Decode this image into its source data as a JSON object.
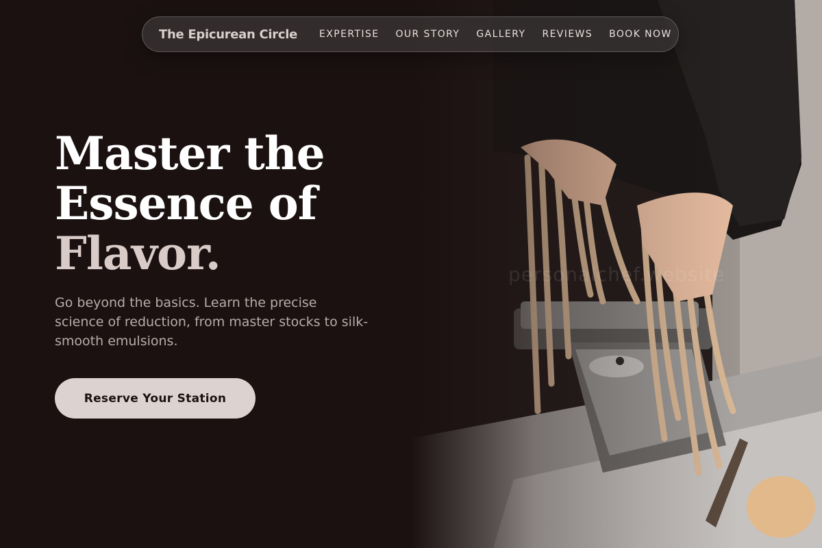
{
  "nav": {
    "brand": "The Epicurean Circle",
    "links": [
      "EXPERTISE",
      "OUR STORY",
      "GALLERY",
      "REVIEWS",
      "BOOK NOW"
    ]
  },
  "hero": {
    "headline_line1": "Master the",
    "headline_line2": "Essence of",
    "headline_line3": "Flavor.",
    "subtitle": "Go beyond the basics. Learn the precise science of reduction, from master stocks to silk-smooth emulsions.",
    "cta_label": "Reserve Your Station",
    "watermark": "personalchef.website"
  },
  "colors": {
    "background": "#1b1111",
    "accent": "#dcd2cf",
    "headline": "#ffffff",
    "subtitle": "#b8adaa"
  },
  "icons": [
    "hero-photo-pasta-machine"
  ]
}
